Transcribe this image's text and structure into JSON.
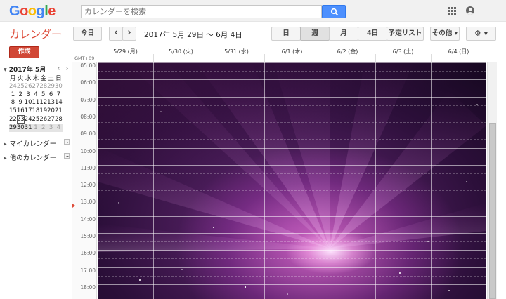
{
  "header": {
    "logo_letters": [
      {
        "ch": "G",
        "color": "#4285f4"
      },
      {
        "ch": "o",
        "color": "#ea4335"
      },
      {
        "ch": "o",
        "color": "#fbbc05"
      },
      {
        "ch": "g",
        "color": "#4285f4"
      },
      {
        "ch": "l",
        "color": "#34a853"
      },
      {
        "ch": "e",
        "color": "#ea4335"
      }
    ],
    "search_placeholder": "カレンダーを検索",
    "icons": [
      "search-icon",
      "apps-grid-icon",
      "account-avatar-icon"
    ]
  },
  "toolbar": {
    "app_title": "カレンダー",
    "today_label": "今日",
    "prev_glyph": "‹",
    "next_glyph": "›",
    "date_range": "2017年 5月 29日 ～ 6月 4日",
    "views": [
      "日",
      "週",
      "月",
      "4日",
      "予定リスト"
    ],
    "active_view": "週",
    "more_label": "その他 ▾",
    "settings_icon": "gear-icon",
    "settings_label": "⚙ ▾",
    "create_label": "作成"
  },
  "mini_calendar": {
    "title": "2017年 5月",
    "prev_glyph": "‹",
    "next_glyph": "›",
    "weekdays": [
      "月",
      "火",
      "水",
      "木",
      "金",
      "土",
      "日"
    ],
    "weeks": [
      [
        {
          "d": "24",
          "o": true
        },
        {
          "d": "25",
          "o": true
        },
        {
          "d": "26",
          "o": true
        },
        {
          "d": "27",
          "o": true
        },
        {
          "d": "28",
          "o": true
        },
        {
          "d": "29",
          "o": true
        },
        {
          "d": "30",
          "o": true
        }
      ],
      [
        {
          "d": "1"
        },
        {
          "d": "2"
        },
        {
          "d": "3"
        },
        {
          "d": "4"
        },
        {
          "d": "5"
        },
        {
          "d": "6"
        },
        {
          "d": "7"
        }
      ],
      [
        {
          "d": "8"
        },
        {
          "d": "9"
        },
        {
          "d": "10"
        },
        {
          "d": "11"
        },
        {
          "d": "12"
        },
        {
          "d": "13"
        },
        {
          "d": "14"
        }
      ],
      [
        {
          "d": "15"
        },
        {
          "d": "16"
        },
        {
          "d": "17"
        },
        {
          "d": "18"
        },
        {
          "d": "19"
        },
        {
          "d": "20"
        },
        {
          "d": "21"
        }
      ],
      [
        {
          "d": "22"
        },
        {
          "d": "23",
          "today": true
        },
        {
          "d": "24"
        },
        {
          "d": "25"
        },
        {
          "d": "26"
        },
        {
          "d": "27"
        },
        {
          "d": "28"
        }
      ],
      [
        {
          "d": "29",
          "hl": true
        },
        {
          "d": "30",
          "hl": true
        },
        {
          "d": "31",
          "hl": true
        },
        {
          "d": "1",
          "o": true,
          "hl": true
        },
        {
          "d": "2",
          "o": true,
          "hl": true
        },
        {
          "d": "3",
          "o": true,
          "hl": true
        },
        {
          "d": "4",
          "o": true,
          "hl": true
        }
      ]
    ]
  },
  "sidebar": {
    "my_calendars": "マイカレンダー",
    "other_calendars": "他のカレンダー"
  },
  "week": {
    "timezone": "GMT+09",
    "days": [
      "5/29 (月)",
      "5/30 (火)",
      "5/31 (水)",
      "6/1 (木)",
      "6/2 (金)",
      "6/3 (土)",
      "6/4 (日)"
    ],
    "hours": [
      "05:00",
      "06:00",
      "07:00",
      "08:00",
      "09:00",
      "10:00",
      "11:00",
      "12:00",
      "13:00",
      "14:00",
      "15:00",
      "16:00",
      "17:00",
      "18:00"
    ],
    "current_time_hour": "12:00",
    "background_image": "aurora-space-wallpaper"
  }
}
